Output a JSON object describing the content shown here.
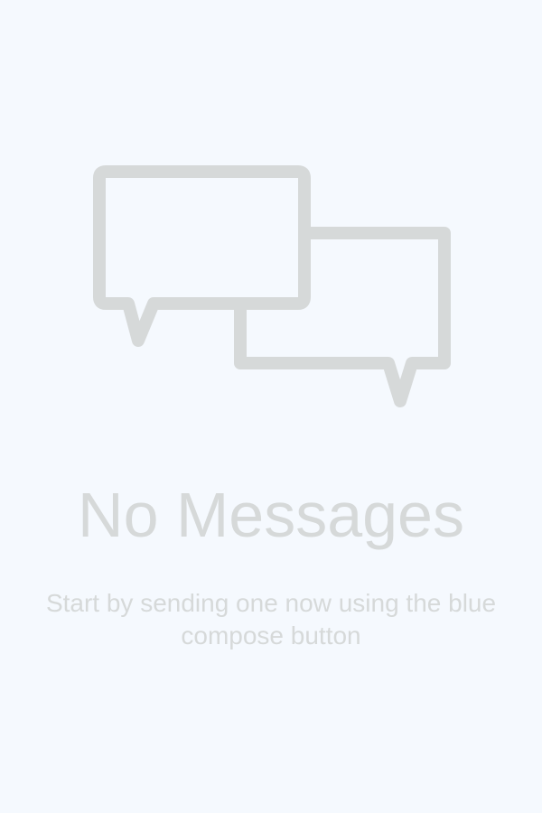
{
  "empty_state": {
    "icon": "chat-bubbles-icon",
    "title": "No Messages",
    "subtitle": "Start by sending one now using the blue compose button"
  },
  "colors": {
    "background": "#f5f9fe",
    "icon_stroke": "#d6d9d9",
    "text": "#d6d9d9"
  }
}
